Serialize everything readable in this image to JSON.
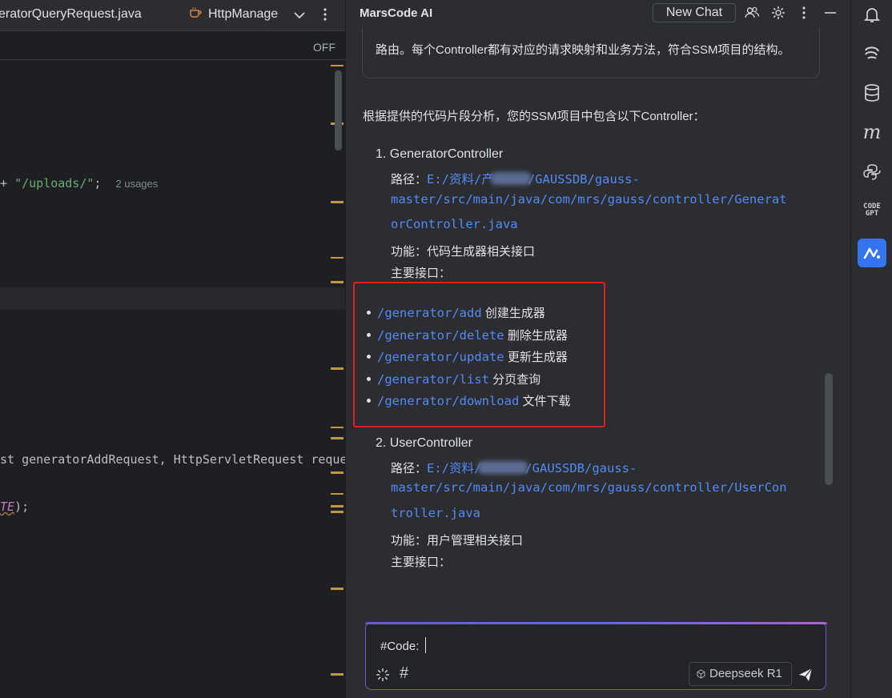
{
  "editor": {
    "tabs": [
      {
        "label": "eratorQueryRequest.java"
      },
      {
        "label": "HttpManage"
      }
    ],
    "off_label": "OFF",
    "code": {
      "uploads_line": {
        "prefix": "+ ",
        "string": "\"/uploads/\"",
        "suffix": ";",
        "hint": "2 usages"
      },
      "method_line": "st generatorAddRequest, HttpServletRequest reques",
      "const_line": {
        "const": "TE",
        "suffix": ");"
      }
    }
  },
  "chat": {
    "title": "MarsCode AI",
    "new_chat_label": "New Chat",
    "previous_text": "路由。每个Controller都有对应的请求映射和业务方法，符合SSM项目的结构。",
    "intro": "根据提供的代码片段分析，您的SSM项目中包含以下Controller：",
    "controllers": [
      {
        "title": "1. GeneratorController",
        "path_label": "路径：",
        "path_part1_a": "E:/资料/产",
        "path_part1_b": "/GAUSSDB/gauss-",
        "path_part2": "master/src/main/java/com/mrs/gauss/controller/Generat",
        "path_part3": "orController.java",
        "function": "功能：代码生成器相关接口",
        "apis_label": "主要接口：",
        "endpoints": [
          {
            "path": "/generator/add",
            "desc": "创建生成器"
          },
          {
            "path": "/generator/delete",
            "desc": "删除生成器"
          },
          {
            "path": "/generator/update",
            "desc": "更新生成器"
          },
          {
            "path": "/generator/list",
            "desc": "分页查询"
          },
          {
            "path": "/generator/download",
            "desc": "文件下载"
          }
        ]
      },
      {
        "title": "2. UserController",
        "path_label": "路径：",
        "path_part1_a": "E:/资料/",
        "path_part1_b": "/GAUSSDB/gauss-",
        "path_part2": "master/src/main/java/com/mrs/gauss/controller/UserCon",
        "path_part3": "troller.java",
        "function": "功能：用户管理相关接口",
        "apis_label": "主要接口："
      }
    ],
    "input": {
      "value": "#Code:"
    },
    "model": "Deepseek R1",
    "colors": {
      "accent": "#3574f0",
      "link": "#548af7",
      "highlight_box": "#e02020"
    }
  },
  "toolstrip": {
    "icons": [
      "notifications-icon",
      "swirl-plugin-icon",
      "database-icon",
      "m-plugin-icon",
      "python-icon",
      "codegpt-icon",
      "marscode-icon"
    ],
    "codegpt_text_1": "CODE",
    "codegpt_text_2": "GPT"
  }
}
